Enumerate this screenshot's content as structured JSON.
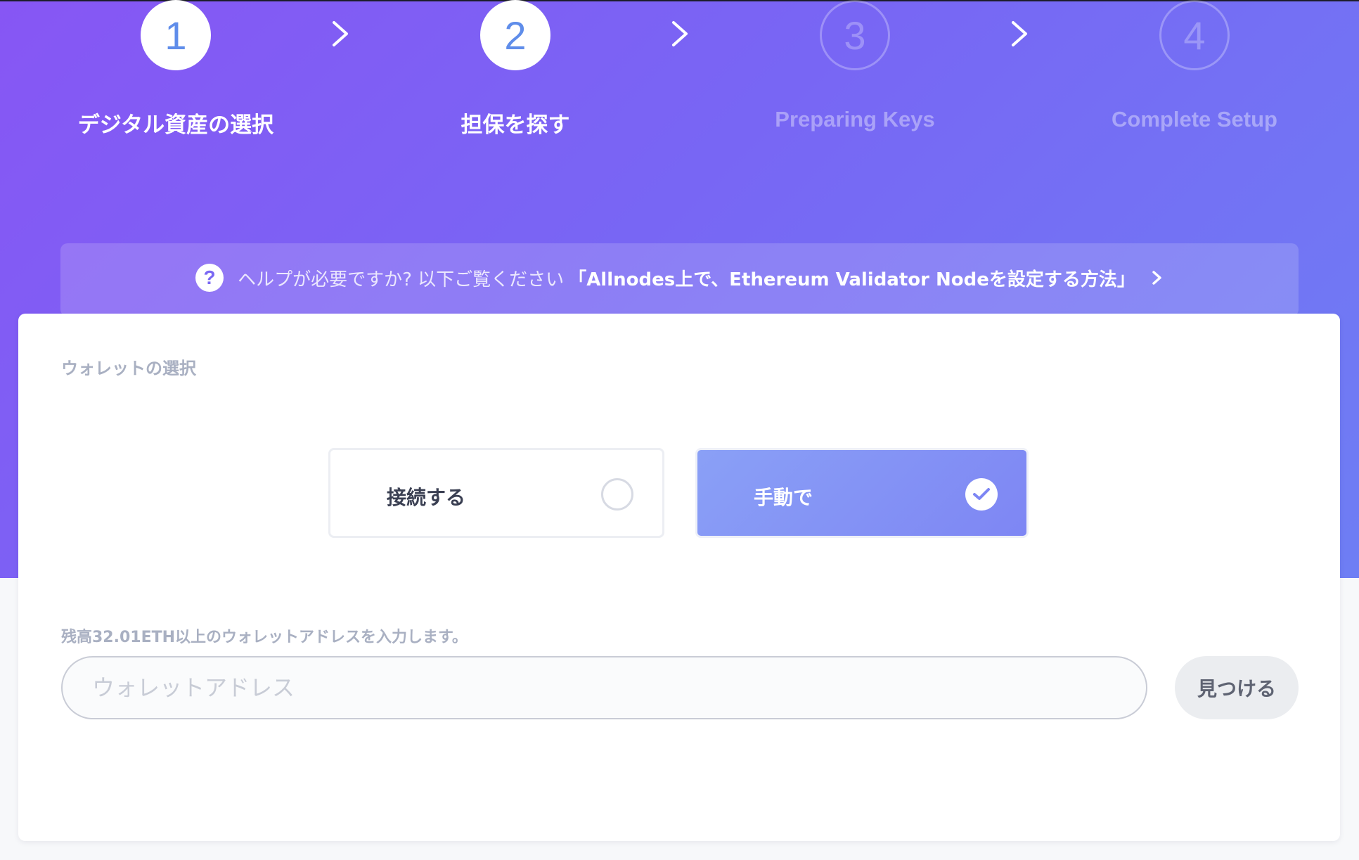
{
  "steps": [
    {
      "number": "1",
      "label": "デジタル資産の選択",
      "state": "active"
    },
    {
      "number": "2",
      "label": "担保を探す",
      "state": "active"
    },
    {
      "number": "3",
      "label": "Preparing Keys",
      "state": "inactive"
    },
    {
      "number": "4",
      "label": "Complete Setup",
      "state": "inactive"
    }
  ],
  "help": {
    "icon": "question-icon",
    "text": "ヘルプが必要ですか? 以下ご覧ください",
    "link": "「Allnodes上で、Ethereum Validator Nodeを設定する方法」"
  },
  "wallet": {
    "title": "ウォレットの選択",
    "options": [
      {
        "label": "接続する",
        "selected": false
      },
      {
        "label": "手動で",
        "selected": true
      }
    ],
    "address_label": "残高32.01ETH以上のウォレットアドレスを入力します。",
    "address_placeholder": "ウォレットアドレス",
    "address_value": "",
    "find_button": "見つける"
  },
  "colors": {
    "accent": "#5f8dea",
    "gradient_start": "#8756f4",
    "gradient_end": "#6e7ef4",
    "selected_option": "#8a96f5"
  }
}
